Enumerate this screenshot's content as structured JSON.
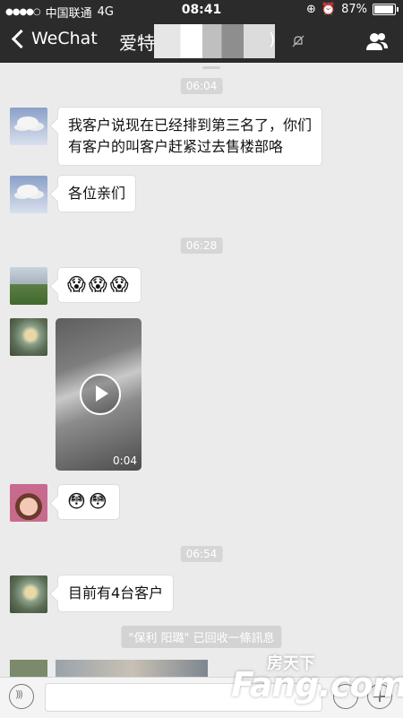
{
  "status_bar": {
    "signal_dots": "●●●●○",
    "carrier": "中国联通",
    "network": "4G",
    "time": "08:41",
    "battery_text": "87%",
    "battery_level": 0.87
  },
  "nav": {
    "back_label": "WeChat",
    "title_visible": "爱特",
    "title_suffix": ")"
  },
  "timestamps": [
    "06:04",
    "06:28",
    "06:54"
  ],
  "messages": [
    {
      "text_line1": "我客户说现在已经排到第三名了，你们",
      "text_line2": "有客户的叫客户赶紧过去售楼部咯"
    },
    {
      "text": "各位亲们"
    },
    {
      "emojis": [
        "😱",
        "😱",
        "😱"
      ]
    },
    {
      "video_duration": "0:04"
    },
    {
      "emojis": [
        "😳",
        "😳"
      ]
    },
    {
      "text": "目前有4台客户"
    }
  ],
  "system_message": "\"保利 阳璐\" 已回收一條訊息",
  "watermark": {
    "cn": "房天下",
    "en": "Fang.com"
  }
}
